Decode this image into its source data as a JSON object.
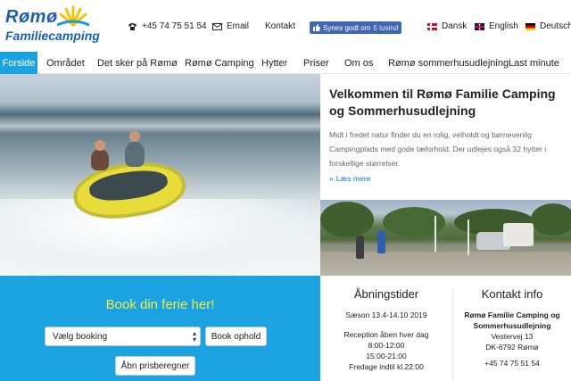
{
  "brand": {
    "line1": "Rømø",
    "line2": "Familiecamping",
    "colors": {
      "blue": "#1a5fb4",
      "sun": "#f5c400",
      "accent": "#1aa3e0",
      "book_heading": "#f2ea47"
    }
  },
  "top": {
    "phone": {
      "icon": "phone-icon",
      "text": "+45 74 75 51 54"
    },
    "email": {
      "icon": "envelope-icon",
      "text": "Email"
    },
    "contact": "Kontakt",
    "facebook": {
      "icon": "thumbs-up-icon",
      "label": "Synes godt om",
      "count": "5 tusind"
    },
    "languages": [
      {
        "label": "Dansk",
        "flag": "flag-dk"
      },
      {
        "label": "English",
        "flag": "flag-uk"
      },
      {
        "label": "Deutsch",
        "flag": "flag-de"
      }
    ]
  },
  "nav": {
    "items": [
      {
        "label": "Forside",
        "active": true
      },
      {
        "label": "Området"
      },
      {
        "label": "Det sker på Rømø"
      },
      {
        "label": "Rømø Camping"
      },
      {
        "label": "Hytter"
      },
      {
        "label": "Priser"
      },
      {
        "label": "Om os"
      },
      {
        "label": "Rømø sommerhusudlejning"
      },
      {
        "label": "Last minute"
      }
    ]
  },
  "welcome": {
    "title": "Velkommen til Rømø Familie Camping og Sommerhusudlejning",
    "body": "Midt i fredet natur finder du en rolig, velholdt og børnevenlig Campingplads med gode læforhold. Der udlejes også 32 hytter i forskellige størrelser.",
    "more": "Læs mere"
  },
  "booking": {
    "heading": "Book din ferie her!",
    "select_value": "Vælg booking",
    "book_button": "Book ophold",
    "calc_button": "Åbn prisberegner"
  },
  "hours": {
    "title": "Åbningstider",
    "season": "Sæson 13.4-14.10 2019",
    "reception": "Reception åben hver dag",
    "time1": "8:00-12:00",
    "time2": "15:00-21:00",
    "friday": "Fredage indtil kl.22:00"
  },
  "contact_info": {
    "title": "Kontakt info",
    "name1": "Rømø Familie Camping og",
    "name2": "Sommerhusudlejning",
    "street": "Vestervej 13",
    "city": "DK-6792 Rømø",
    "phone": "+45 74 75 51 54"
  }
}
